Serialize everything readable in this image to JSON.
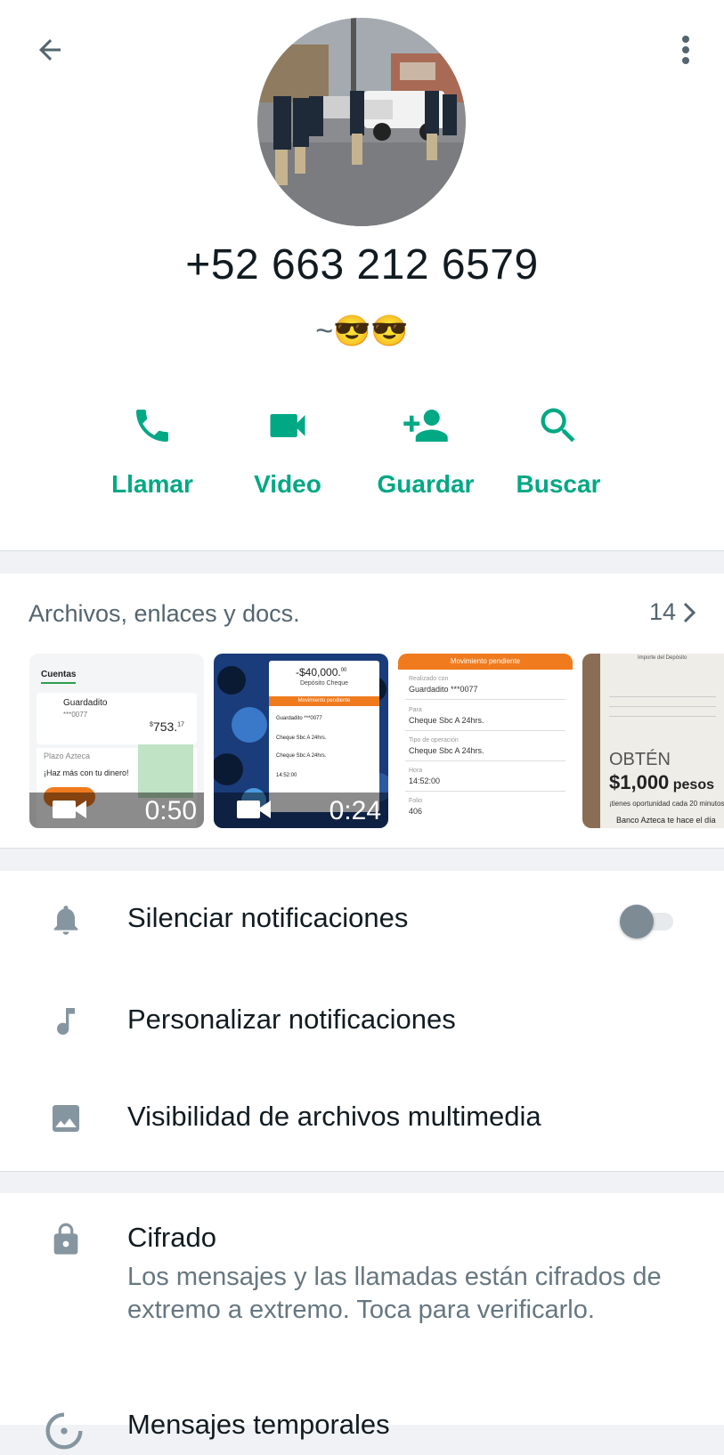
{
  "contact": {
    "phone": "+52 663 212 6579",
    "about": "~😎😎"
  },
  "actions": [
    {
      "label": "Llamar",
      "icon": "phone-icon"
    },
    {
      "label": "Video",
      "icon": "video-camera-icon"
    },
    {
      "label": "Guardar",
      "icon": "add-contact-icon"
    },
    {
      "label": "Buscar",
      "icon": "search-icon"
    }
  ],
  "media": {
    "title": "Archivos, enlaces y docs.",
    "count": "14",
    "thumbnails": [
      {
        "type": "video",
        "duration": "0:50",
        "header": "Cuentas",
        "account": "Guardadito",
        "account_no": "***0077",
        "amount_sup": "$",
        "amount": "753.",
        "amount_cents": "17",
        "promo_title": "Plazo Azteca",
        "promo_text": "¡Haz más con tu dinero!"
      },
      {
        "type": "video",
        "duration": "0:24",
        "amount": "-$40,000.",
        "amount_cents": "00",
        "deposit": "Depósito Cheque",
        "status": "Movimiento pendiente",
        "from": "Guardadito ***0077",
        "to": "Cheque Sbc A 24hrs.",
        "op_type": "Cheque Sbc A 24hrs.",
        "time": "14:52:00"
      },
      {
        "type": "image",
        "status": "Movimiento pendiente",
        "from_label": "Realizado con",
        "from": "Guardadito ***0077",
        "to_label": "Para",
        "to": "Cheque Sbc A 24hrs.",
        "op_label": "Tipo de operación",
        "op": "Cheque Sbc A 24hrs.",
        "time_label": "Hora",
        "time": "14:52:00",
        "folio_label": "Folio",
        "folio": "406"
      },
      {
        "type": "image",
        "header": "Importe del Depósito",
        "promo1": "OBTÉN",
        "promo2": "$1,000",
        "promo3": "pesos",
        "promo4": "¡tienes oportunidad cada 20 minutos!",
        "footer": "Banco Azteca te hace el día"
      }
    ]
  },
  "settings": [
    {
      "label": "Silenciar notificaciones",
      "icon": "bell-icon",
      "toggle": false
    },
    {
      "label": "Personalizar notificaciones",
      "icon": "music-note-icon"
    },
    {
      "label": "Visibilidad de archivos multimedia",
      "icon": "image-icon"
    }
  ],
  "encryption": {
    "title": "Cifrado",
    "description": "Los mensajes y las llamadas están cifrados de extremo a extremo. Toca para verificarlo."
  },
  "temporary": {
    "label": "Mensajes temporales"
  },
  "colors": {
    "accent": "#00a884",
    "icon_gray": "#54656f",
    "text_primary": "#111b21",
    "text_secondary": "#667781"
  }
}
